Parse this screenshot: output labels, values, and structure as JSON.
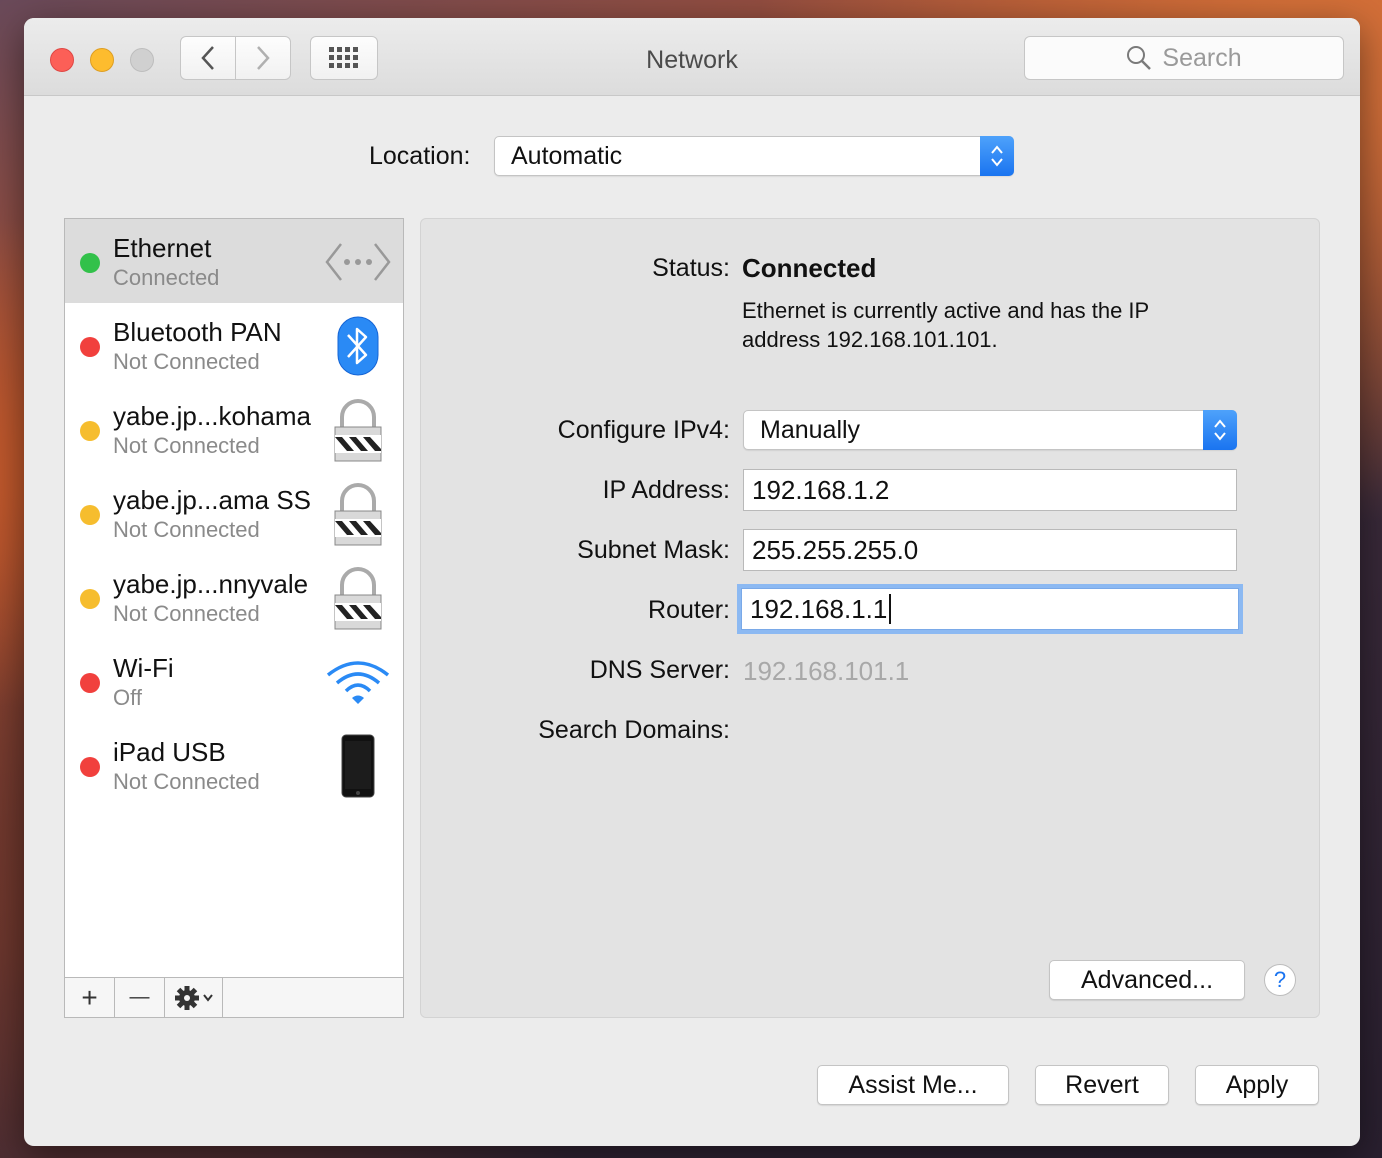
{
  "window": {
    "title": "Network",
    "search_placeholder": "Search"
  },
  "location": {
    "label": "Location:",
    "value": "Automatic"
  },
  "services": [
    {
      "name": "Ethernet",
      "status": "Connected",
      "dot_color": "#32c14a",
      "icon": "ethernet-arrows-icon",
      "selected": true
    },
    {
      "name": "Bluetooth PAN",
      "status": "Not Connected",
      "dot_color": "#f1403d",
      "icon": "bluetooth-icon"
    },
    {
      "name": "yabe.jp...kohama",
      "status": "Not Connected",
      "dot_color": "#f6bd2e",
      "icon": "vpn-lock-icon"
    },
    {
      "name": "yabe.jp...ama SS",
      "status": "Not Connected",
      "dot_color": "#f6bd2e",
      "icon": "vpn-lock-icon"
    },
    {
      "name": "yabe.jp...nnyvale",
      "status": "Not Connected",
      "dot_color": "#f6bd2e",
      "icon": "vpn-lock-icon"
    },
    {
      "name": "Wi-Fi",
      "status": "Off",
      "dot_color": "#f1403d",
      "icon": "wifi-icon"
    },
    {
      "name": "iPad USB",
      "status": "Not Connected",
      "dot_color": "#f1403d",
      "icon": "ipad-icon"
    }
  ],
  "sidebar_toolbar": {
    "add": "+",
    "remove": "—"
  },
  "detail": {
    "status_label": "Status:",
    "status_value": "Connected",
    "status_desc_line1": "Ethernet is currently active and has the IP",
    "status_desc_line2": "address 192.168.101.101.",
    "configure_label": "Configure IPv4:",
    "configure_value": "Manually",
    "ip_label": "IP Address:",
    "ip_value": "192.168.1.2",
    "subnet_label": "Subnet Mask:",
    "subnet_value": "255.255.255.0",
    "router_label": "Router:",
    "router_value": "192.168.1.1",
    "dns_label": "DNS Server:",
    "dns_value": "192.168.101.1",
    "search_domains_label": "Search Domains:",
    "advanced_label": "Advanced...",
    "help_label": "?"
  },
  "footer": {
    "assist_label": "Assist Me...",
    "revert_label": "Revert",
    "apply_label": "Apply"
  },
  "colors": {
    "accent": "#1a74f0",
    "focus_ring": "#8cb9f2"
  }
}
